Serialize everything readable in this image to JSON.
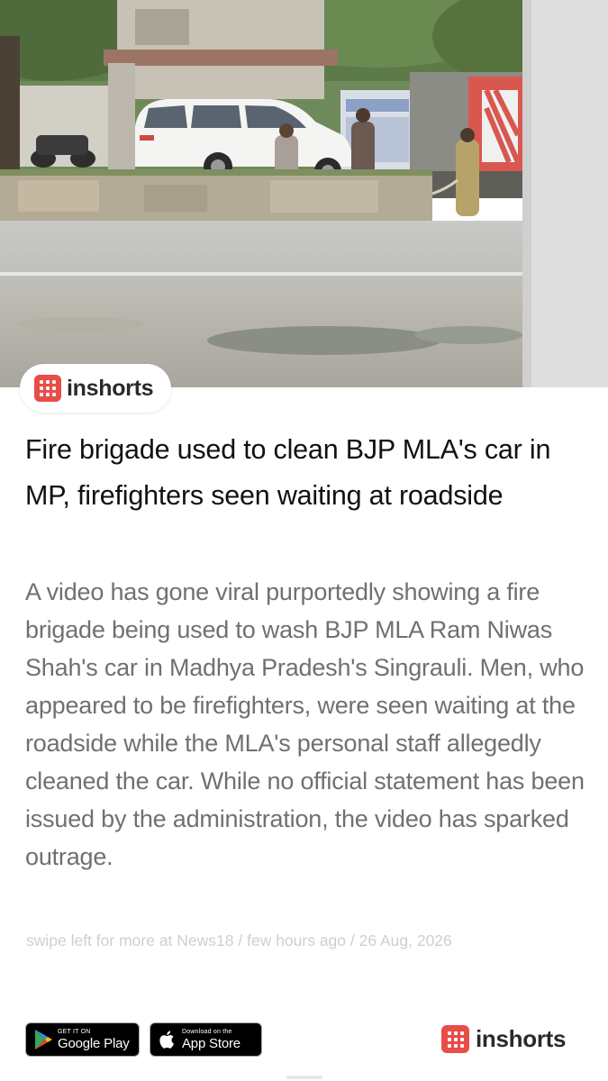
{
  "brand": {
    "name": "inshorts",
    "color": "#ea4c48"
  },
  "photo": {
    "caption": ""
  },
  "article": {
    "headline": "Fire brigade used to clean BJP MLA's car in MP, firefighters seen waiting at roadside",
    "body": "A video has gone viral purportedly showing a fire brigade being used to wash BJP MLA Ram Niwas Shah's car in Madhya Pradesh's Singrauli. Men, who appeared to be firefighters, were seen waiting at the roadside while the MLA's personal staff allegedly cleaned the car. While no official statement has been issued by the administration, the video has sparked outrage.",
    "meta": "swipe left for more at News18 / few hours ago / 26 Aug, 2026"
  },
  "footer": {
    "google_play": {
      "small": "GET IT ON",
      "big": "Google Play",
      "icon": "google-play-icon"
    },
    "app_store": {
      "small": "Download on the",
      "big": "App Store",
      "icon": "apple-icon"
    },
    "brand_name": "inshorts"
  },
  "colors": {
    "headline": "#111111",
    "body": "#707070",
    "meta": "#cfcfcf"
  }
}
